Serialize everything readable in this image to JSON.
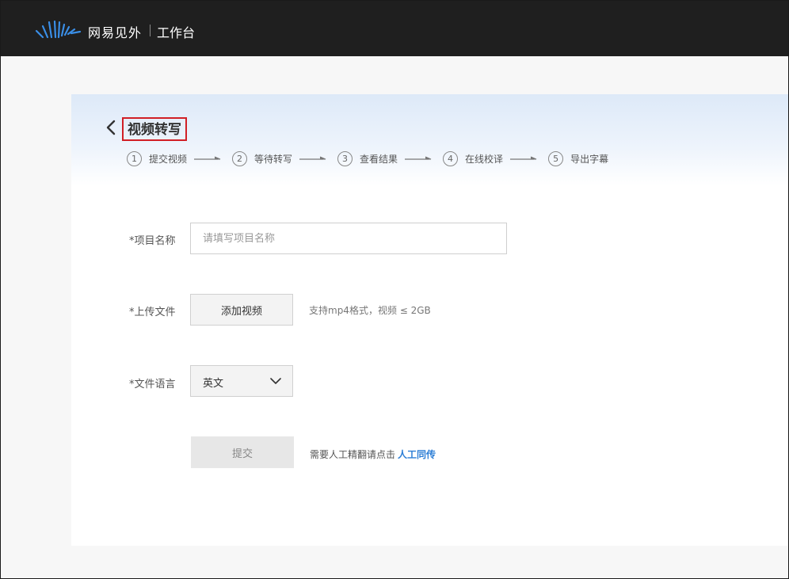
{
  "header": {
    "brand": "网易见外",
    "subtitle": "工作台"
  },
  "page": {
    "title": "视频转写",
    "steps": [
      {
        "num": "1",
        "label": "提交视频"
      },
      {
        "num": "2",
        "label": "等待转写"
      },
      {
        "num": "3",
        "label": "查看结果"
      },
      {
        "num": "4",
        "label": "在线校译"
      },
      {
        "num": "5",
        "label": "导出字幕"
      }
    ]
  },
  "form": {
    "project_name_label": "*项目名称",
    "project_name_placeholder": "请填写项目名称",
    "project_name_value": "",
    "upload_label": "*上传文件",
    "upload_button": "添加视频",
    "upload_hint": "支持mp4格式，视频 ≤ 2GB",
    "language_label": "*文件语言",
    "language_value": "英文",
    "submit_button": "提交",
    "human_hint": "需要人工精翻请点击",
    "human_link": "人工同传"
  },
  "colors": {
    "header_bg": "#1f1f1f",
    "highlight_border": "#d11f26",
    "link": "#2e7fd6",
    "logo": "#3a8ee6"
  }
}
